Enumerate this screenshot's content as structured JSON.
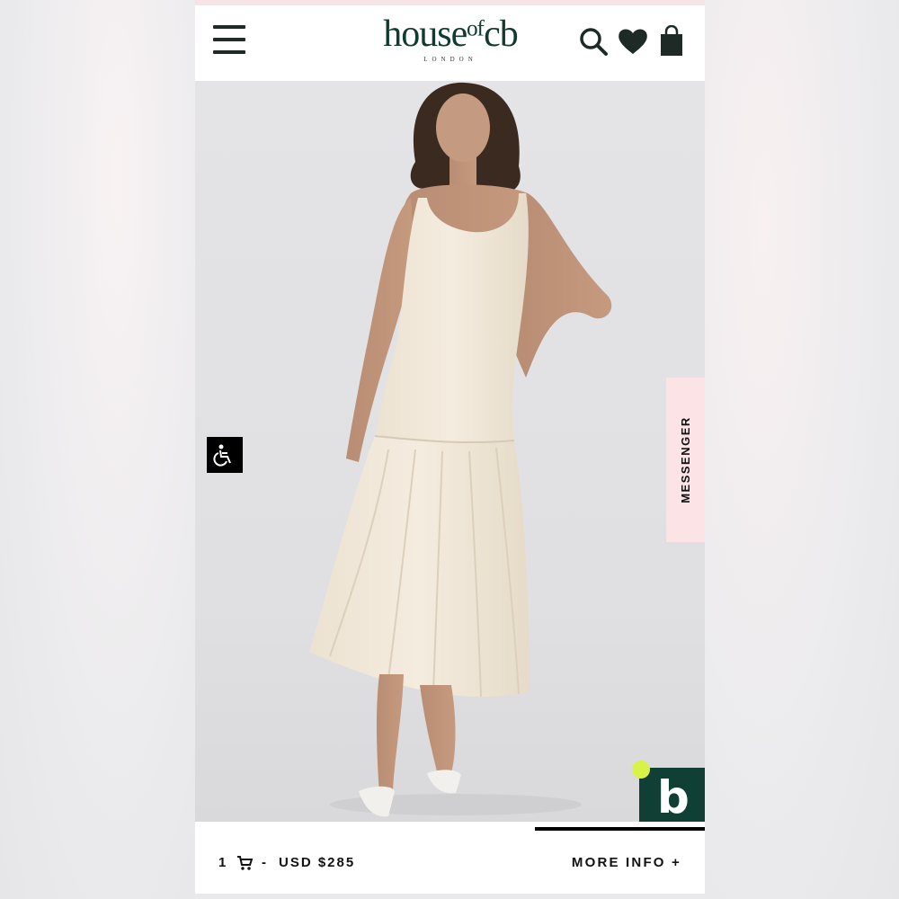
{
  "brand": {
    "logo_text": "house of cb",
    "logo_main": "houseᵒᶠcb",
    "logo_sub": "LONDON",
    "color": "#123b30"
  },
  "header": {
    "menu_icon": "menu-icon",
    "search_icon": "search-icon",
    "wishlist_icon": "heart-icon",
    "bag_icon": "shopping-bag-icon"
  },
  "product_image": {
    "dress_color": "#f1e8da",
    "background": "#e2e2e4"
  },
  "widgets": {
    "accessibility_icon": "wheelchair-icon",
    "messenger_label": "MESSENGER",
    "badge_letter": "b",
    "badge_color": "#0f3f35",
    "badge_dot_color": "#d9f24a"
  },
  "bottom_bar": {
    "quantity": "1",
    "cart_icon": "cart-icon",
    "separator": "-",
    "price": "USD $285",
    "more_info_label": "MORE INFO +"
  }
}
